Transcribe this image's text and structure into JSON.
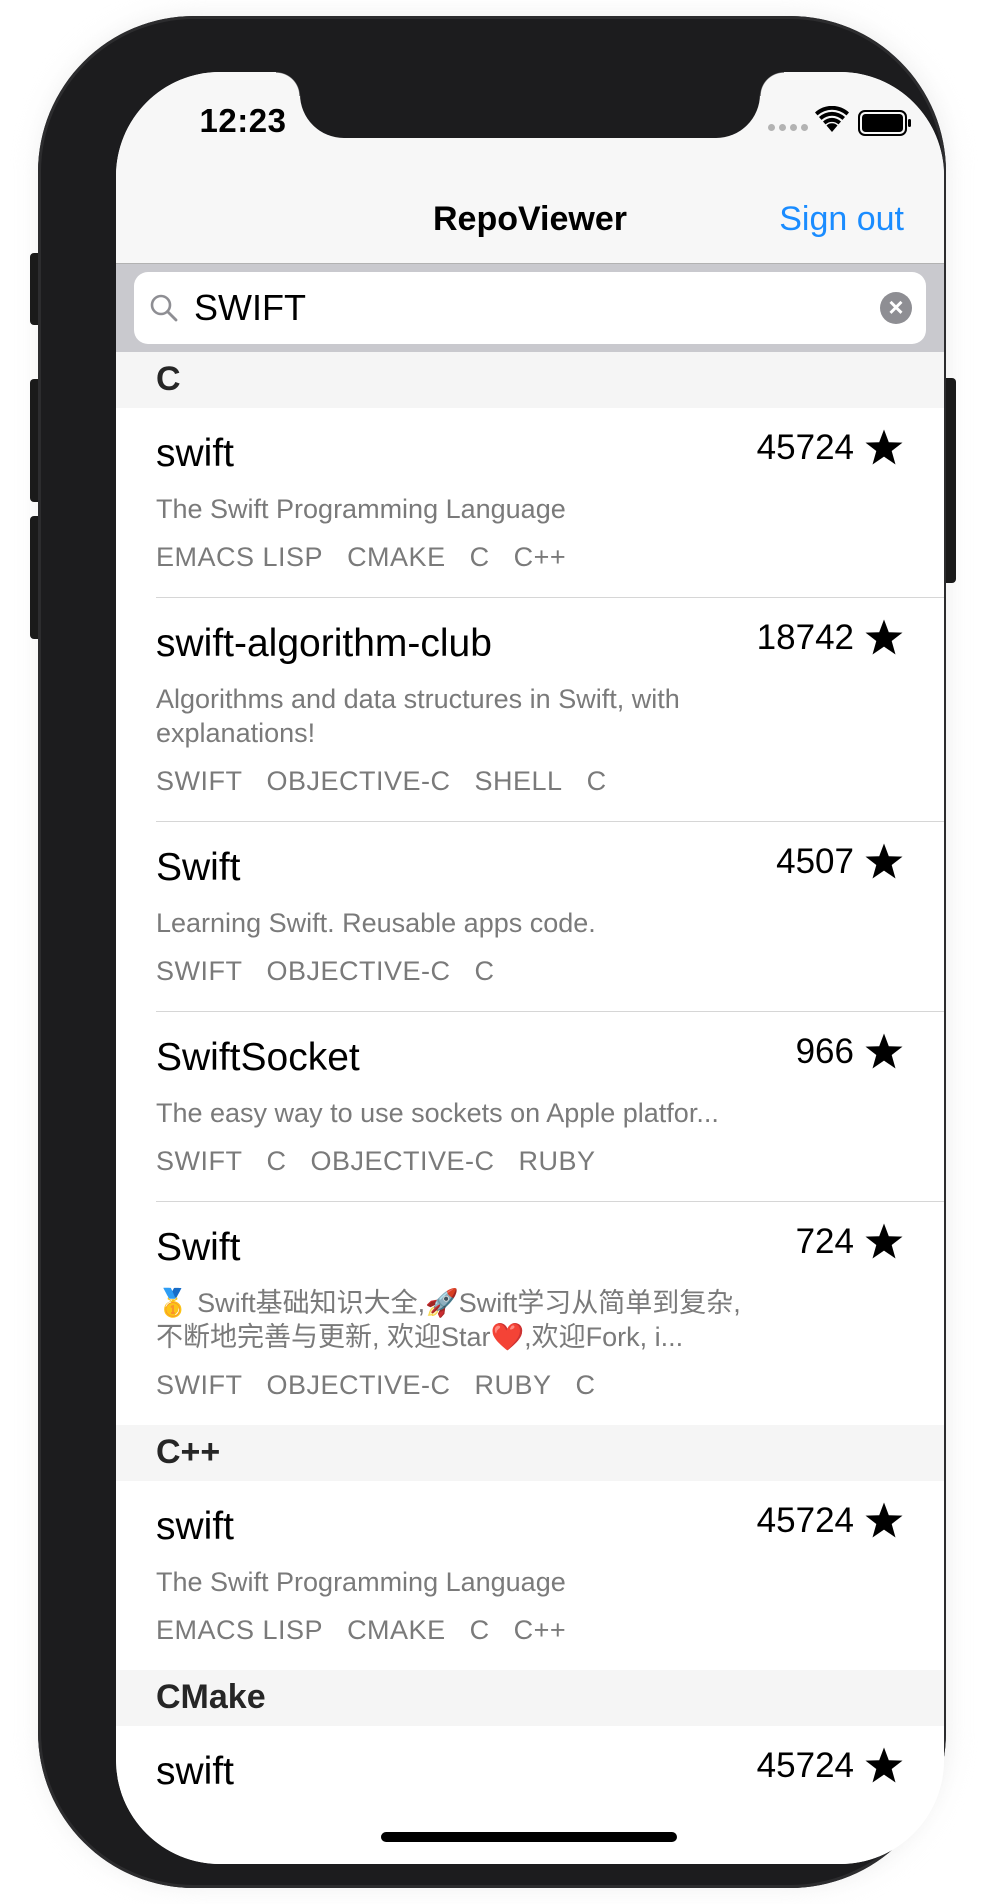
{
  "status_bar": {
    "time": "12:23"
  },
  "nav": {
    "title": "RepoViewer",
    "action": "Sign out"
  },
  "search": {
    "value": "SWIFT"
  },
  "sections": [
    {
      "title": "C",
      "rows": [
        {
          "name": "swift",
          "stars": "45724",
          "description": "The Swift Programming Language",
          "languages": [
            "EMACS LISP",
            "CMAKE",
            "C",
            "C++"
          ]
        },
        {
          "name": "swift-algorithm-club",
          "stars": "18742",
          "description": "Algorithms and data structures in Swift, with explanations!",
          "languages": [
            "SWIFT",
            "OBJECTIVE-C",
            "SHELL",
            "C"
          ]
        },
        {
          "name": "Swift",
          "stars": "4507",
          "description": "Learning Swift. Reusable apps code.",
          "languages": [
            "SWIFT",
            "OBJECTIVE-C",
            "C"
          ]
        },
        {
          "name": "SwiftSocket",
          "stars": "966",
          "description": "The easy way to use sockets on Apple platfor...",
          "languages": [
            "SWIFT",
            "C",
            "OBJECTIVE-C",
            "RUBY"
          ]
        },
        {
          "name": "Swift",
          "stars": "724",
          "description": "🥇 Swift基础知识大全,🚀Swift学习从简单到复杂,不断地完善与更新, 欢迎Star❤️,欢迎Fork, i...",
          "languages": [
            "SWIFT",
            "OBJECTIVE-C",
            "RUBY",
            "C"
          ]
        }
      ]
    },
    {
      "title": "C++",
      "rows": [
        {
          "name": "swift",
          "stars": "45724",
          "description": "The Swift Programming Language",
          "languages": [
            "EMACS LISP",
            "CMAKE",
            "C",
            "C++"
          ]
        }
      ]
    },
    {
      "title": "CMake",
      "rows": [
        {
          "name": "swift",
          "stars": "45724",
          "description": "",
          "languages": []
        }
      ]
    }
  ],
  "colors": {
    "accent": "#1a8cff",
    "section_bg": "#f5f5f5",
    "secondary_text": "#7a7a7a"
  },
  "icons": {
    "search": "search-icon",
    "clear": "clear-icon",
    "star": "star-icon",
    "wifi": "wifi-icon",
    "battery": "battery-icon"
  }
}
